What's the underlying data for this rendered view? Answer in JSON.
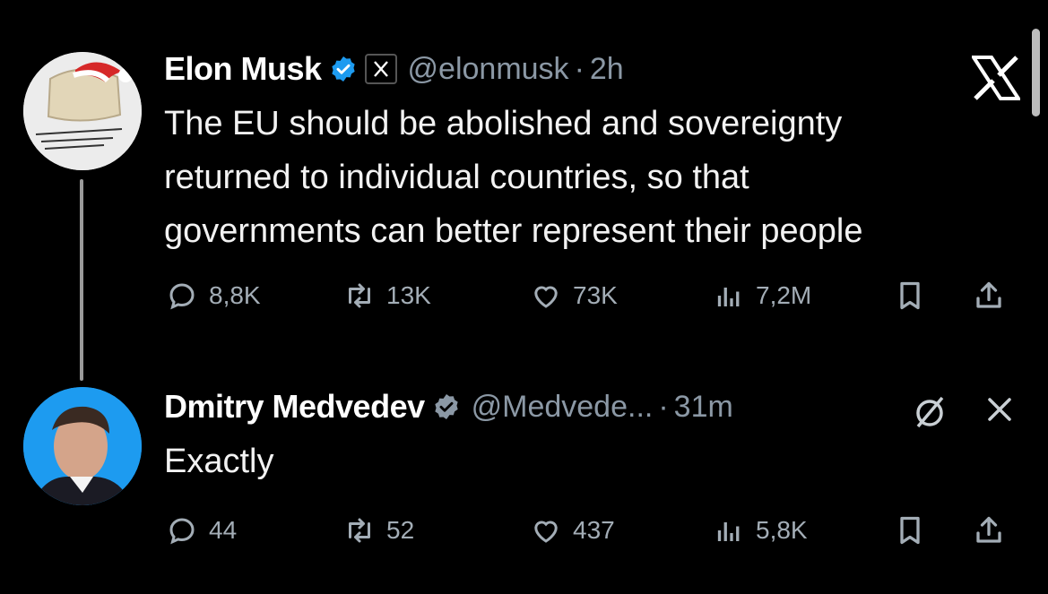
{
  "tweets": [
    {
      "name": "Elon Musk",
      "handle": "@elonmusk",
      "separator": "·",
      "time": "2h",
      "text_lines": [
        "The EU should be abolished and sovereignty",
        "returned to individual countries, so that",
        "governments can better represent their people"
      ],
      "stats": {
        "replies": "8,8K",
        "retweets": "13K",
        "likes": "73K",
        "views": "7,2M"
      }
    },
    {
      "name": "Dmitry Medvedev",
      "handle": "@Medvede...",
      "separator": "·",
      "time": "31m",
      "text_lines": [
        "Exactly"
      ],
      "stats": {
        "replies": "44",
        "retweets": "52",
        "likes": "437",
        "views": "5,8K"
      }
    }
  ],
  "colors": {
    "background": "#000000",
    "text": "#e7e9ea",
    "muted": "#8b98a5",
    "verified": "#1d9bf0"
  }
}
